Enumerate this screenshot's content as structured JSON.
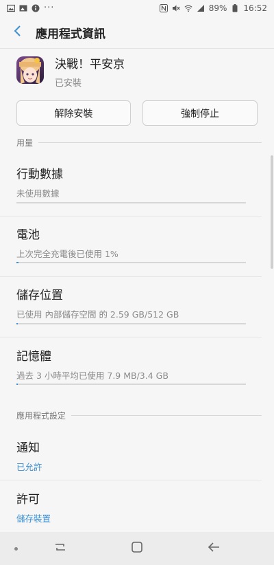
{
  "status_bar": {
    "battery": "89%",
    "time": "16:52"
  },
  "app_bar": {
    "title": "應用程式資訊"
  },
  "app": {
    "name": "決戰！平安京",
    "status": "已安裝"
  },
  "actions": {
    "uninstall": "解除安裝",
    "force_stop": "強制停止"
  },
  "usage": {
    "header": "用量",
    "items": [
      {
        "title": "行動數據",
        "subtitle": "未使用數據"
      },
      {
        "title": "電池",
        "subtitle": "上次完全充電後已使用 1%",
        "progress": 0.01
      },
      {
        "title": "儲存位置",
        "subtitle": "已使用 內部儲存空間 的 2.59 GB/512 GB",
        "progress": 0.005
      },
      {
        "title": "記憶體",
        "subtitle": "過去 3 小時平均已使用 7.9 MB/3.4 GB",
        "progress": 0.002
      }
    ]
  },
  "settings": {
    "header": "應用程式設定",
    "items": [
      {
        "title": "通知",
        "subtitle": "已允許"
      },
      {
        "title": "許可",
        "subtitle": "儲存裝置"
      }
    ]
  },
  "colors": {
    "accent": "#3d8fd1",
    "background": "#f6f6f6"
  },
  "icons": [
    "back-icon",
    "nav-recent-icon",
    "nav-home-icon",
    "nav-back-icon"
  ]
}
